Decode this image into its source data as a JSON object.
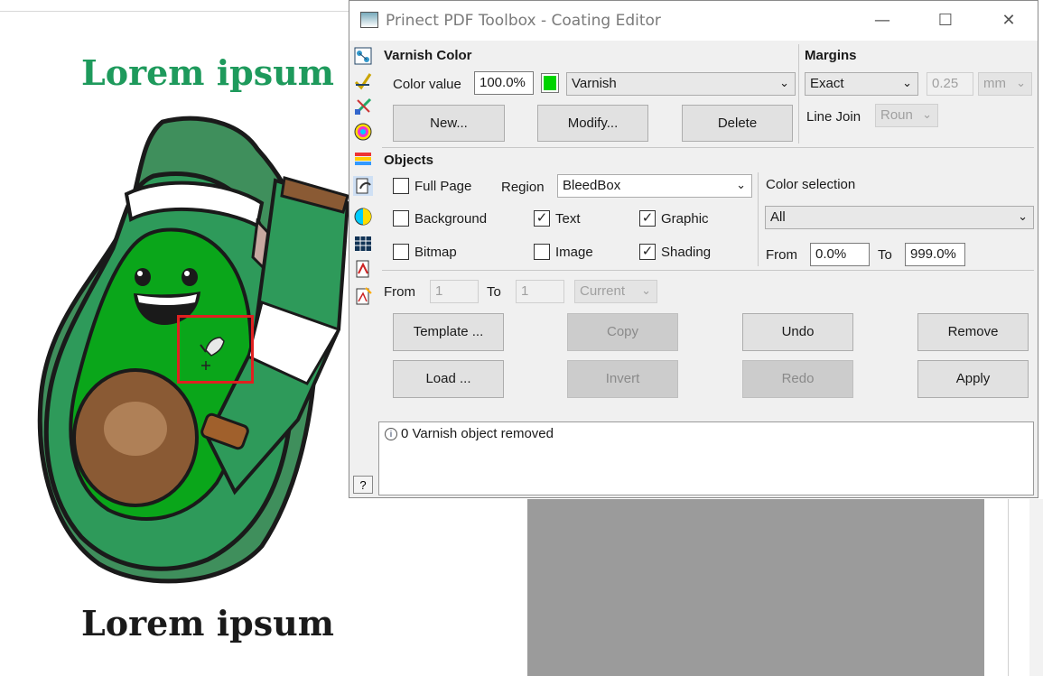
{
  "document": {
    "heading_top": "Lorem ipsum",
    "heading_bottom": "Lorem ipsum"
  },
  "window": {
    "title": "Prinect PDF Toolbox - Coating Editor",
    "minimize": "—",
    "maximize": "☐",
    "close": "✕"
  },
  "varnish_color": {
    "heading": "Varnish Color",
    "color_value_label": "Color value",
    "color_value": "100.0%",
    "swatch_color": "#00d400",
    "color_name": "Varnish",
    "new_label": "New...",
    "modify_label": "Modify...",
    "delete_label": "Delete"
  },
  "margins": {
    "heading": "Margins",
    "mode": "Exact",
    "value": "0.25",
    "unit": "mm",
    "line_join_label": "Line Join",
    "line_join_value": "Roun"
  },
  "objects": {
    "heading": "Objects",
    "full_page_label": "Full Page",
    "full_page_checked": false,
    "region_label": "Region",
    "region_value": "BleedBox",
    "background_label": "Background",
    "background_checked": false,
    "text_label": "Text",
    "text_checked": true,
    "graphic_label": "Graphic",
    "graphic_checked": true,
    "bitmap_label": "Bitmap",
    "bitmap_checked": false,
    "image_label": "Image",
    "image_checked": false,
    "shading_label": "Shading",
    "shading_checked": true,
    "color_selection_label": "Color selection",
    "color_selection_value": "All",
    "from_label": "From",
    "from_value": "0.0%",
    "to_label": "To",
    "to_value": "999.0%"
  },
  "pages": {
    "from_label": "From",
    "from_value": "1",
    "to_label": "To",
    "to_value": "1",
    "scope_value": "Current"
  },
  "actions": {
    "template_label": "Template ...",
    "copy_label": "Copy",
    "undo_label": "Undo",
    "remove_label": "Remove",
    "load_label": "Load ...",
    "invert_label": "Invert",
    "redo_label": "Redo",
    "apply_label": "Apply"
  },
  "log": {
    "message": "0 Varnish object removed"
  },
  "help_label": "?",
  "check_glyph": "✓",
  "chevron_glyph": "⌄",
  "info_glyph": "i",
  "tools": [
    "objects-icon",
    "preflight-check-icon",
    "fix-icon",
    "color-icon",
    "layers-icon",
    "coating-icon",
    "separation-icon",
    "grid-icon",
    "pdf-icon",
    "pdf-export-icon"
  ]
}
